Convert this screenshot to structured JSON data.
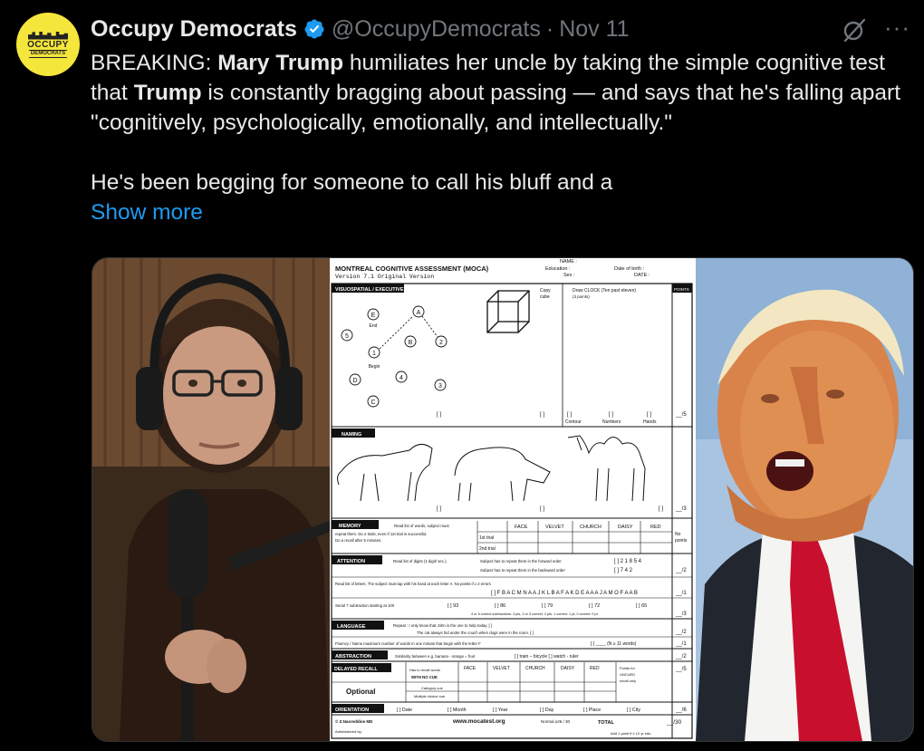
{
  "tweet": {
    "author_name": "Occupy Democrats",
    "handle": "@OccupyDemocrats",
    "separator": "·",
    "date": "Nov 11",
    "more_icon": "···",
    "avatar": {
      "line1": "OCCUPY",
      "line2": "DEMOCRATS"
    },
    "body": {
      "p1": [
        {
          "t": "BREAKING: ",
          "b": false
        },
        {
          "t": "Mary Trump",
          "b": true
        },
        {
          "t": " humiliates her uncle by taking the simple cognitive test that ",
          "b": false
        },
        {
          "t": "Trump",
          "b": true
        },
        {
          "t": " is constantly bragging about passing — and says that he's falling apart \"cognitively, psychologically, emotionally, and intellectually.\"",
          "b": false
        }
      ],
      "p2": "He's been begging for someone to call his bluff and a"
    },
    "show_more": "Show more"
  },
  "moca": {
    "title": "MONTREAL COGNITIVE ASSESSMENT (MOCA)",
    "version": "Version 7.1  Original Version",
    "name": "NAME :",
    "education": "Education :",
    "sex": "Sex :",
    "dob": "Date of birth :",
    "date": "DATE :",
    "visuo": "VISUOSPATIAL / EXECUTIVE",
    "copy_cube": "Copy",
    "cube": "cube",
    "draw_clock": "Draw CLOCK (Ten past eleven)",
    "three_points": "(3 points)",
    "points": "POINTS",
    "trail": [
      "E",
      "A",
      "End",
      "5",
      "B",
      "2",
      "1",
      "Begin",
      "D",
      "4",
      "3",
      "C"
    ],
    "box": "[ ]",
    "contour": "Contour",
    "numbers": "Numbers",
    "hands": "Hands",
    "score5": "__/5",
    "naming": "NAMING",
    "score3": "__/3",
    "memory": "MEMORY",
    "memory_text1": "Read list of words, subject must",
    "memory_text2": "repeat them. Do 2 trials, even if 1st trial is successful.",
    "memory_text3": "Do a recall after 5 minutes.",
    "words": [
      "FACE",
      "VELVET",
      "CHURCH",
      "DAISY",
      "RED"
    ],
    "trial1": "1st trial",
    "trial2": "2nd trial",
    "no_points": [
      "No",
      "points"
    ],
    "attention": "ATTENTION",
    "digits_text": "Read list of digits (1 digit/ sec.).",
    "forward": "Subject has to repeat them in the forward order",
    "backward": "Subject has to repeat them in the backward order",
    "digits_fwd": "[ ] 2 1 8 5 4",
    "digits_bwd": "[ ] 7 4 2",
    "score2": "__/2",
    "letters_text": "Read list of letters. The subject must tap with his hand at each letter A.  No points if  ≥ 2 errors",
    "letters": "[ ]   F B A C M N A A J K L B A F A K D E A A A J A M O F A A B",
    "score1": "__/1",
    "serial": "Serial 7 subtraction starting at 100",
    "serial_vals": [
      "[ ] 93",
      "[ ] 86",
      "[ ] 79",
      "[ ] 72",
      "[ ] 65"
    ],
    "serial_scoring": "4 or 5 correct subtractions:  3 pts,  2 or 3 correct:  2 pts,  1 correct:  1 pt,  0 correct:  0 pt",
    "language": "LANGUAGE",
    "repeat1": "Repeat :  I only know that John is the one to help today.  [ ]",
    "repeat2": "The cat always hid under the couch when dogs were in the room.  [ ]",
    "fluency": "Fluency / Name maximum number of words in one minute that begin with the letter F",
    "fluency_box": "[ ] ____ (N ≥ 11 words)",
    "abstraction": "ABSTRACTION",
    "abstraction_text": "Similarity between e.g. banana - orange = fruit",
    "abstraction_items": "[ ] train – bicycle   [ ] watch - ruler",
    "delayed": "DELAYED RECALL",
    "no_cue1": "Has to recall words",
    "no_cue2": "WITH NO CUE",
    "category_cue": "Category cue",
    "multiple_cue": "Multiple choice cue",
    "optional": "Optional",
    "unc1": "Points for",
    "unc2": "UNCUED",
    "unc3": "recall only",
    "orientation": "ORIENTATION",
    "orient_items": [
      "[ ] Date",
      "[ ] Month",
      "[ ] Year",
      "[ ] Day",
      "[ ] Place",
      "[ ] City"
    ],
    "score6": "__/6",
    "author": "© Z.Nasreddine MD",
    "administered": "Administered by:",
    "url": "www.mocatest.org",
    "normal": "Normal  ≥26 / 30",
    "total": "TOTAL",
    "score30": "__/30",
    "add_point": "Add 1 point if  ≤ 12 yr edu"
  }
}
